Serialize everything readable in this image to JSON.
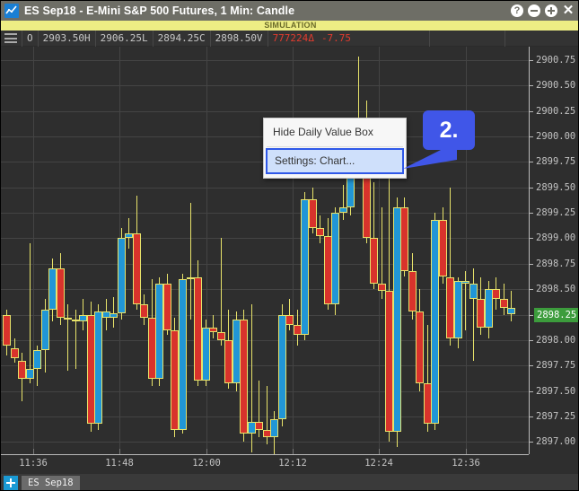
{
  "window": {
    "title": "ES Sep18 - E-Mini S&P 500 Futures, 1 Min: Candle",
    "app_icon": "line-chart-icon",
    "buttons": {
      "help": "?",
      "minimize": "−",
      "maximize": "+",
      "close": "✕"
    }
  },
  "banner": {
    "text": "SIMULATION",
    "background": "#eded84",
    "color": "#6b6b2a"
  },
  "data_bar": {
    "menu_icon": "hamburger-icon",
    "cells": [
      {
        "label": "O",
        "value": ""
      },
      {
        "label": "2903.50H",
        "value": ""
      },
      {
        "label": "2906.25L",
        "value": ""
      },
      {
        "label": "2894.25C",
        "value": ""
      },
      {
        "label": "2898.50V",
        "value": ""
      },
      {
        "label": "777224",
        "value": ""
      }
    ],
    "open": "O",
    "high": "2903.50H",
    "low": "2906.25L",
    "close": "2894.25C",
    "volume_price": "2898.50V",
    "volume": "777224",
    "delta_symbol": "Δ",
    "delta_value": "-7.75",
    "delta_color": "#e23b2e"
  },
  "context_menu": {
    "items": [
      {
        "label": "Hide Daily Value Box",
        "selected": false
      },
      {
        "label": "Settings: Chart...",
        "selected": true
      }
    ],
    "highlight_color": "#2f58e8"
  },
  "callout": {
    "number": "2.",
    "color": "#4056e8"
  },
  "tabbar": {
    "add_label": "+",
    "tabs": [
      {
        "label": "ES Sep18",
        "active": true
      }
    ]
  },
  "chart_data": {
    "type": "candlestick",
    "title": "ES Sep18 - E-Mini S&P 500 Futures, 1 Min: Candle",
    "xlabel": "",
    "ylabel": "",
    "grid": true,
    "legend": "none",
    "up_color": "#2196d6",
    "down_color": "#d8332c",
    "wick_color": "#e8e36a",
    "background": "#2e2e2e",
    "ylim": [
      2896.88,
      2900.88
    ],
    "price_ticks": [
      "2900.75",
      "2900.50",
      "2900.25",
      "2900.00",
      "2899.75",
      "2899.50",
      "2899.25",
      "2899.00",
      "2898.75",
      "2898.50",
      "2898.25",
      "2898.00",
      "2897.75",
      "2897.50",
      "2897.25",
      "2897.00"
    ],
    "current_price": "2898.25",
    "current_price_color": "#3c9c3c",
    "time_ticks": [
      "11:36",
      "11:48",
      "12:00",
      "12:12",
      "12:24",
      "12:36"
    ],
    "tick_interval_minutes": 12,
    "bar_interval": "1 Min",
    "candles": [
      {
        "o": 2898.25,
        "h": 2898.3,
        "l": 2897.85,
        "c": 2897.95,
        "dir": "down"
      },
      {
        "o": 2897.92,
        "h": 2898.02,
        "l": 2897.78,
        "c": 2897.82,
        "dir": "down"
      },
      {
        "o": 2897.8,
        "h": 2897.88,
        "l": 2897.4,
        "c": 2897.62,
        "dir": "down"
      },
      {
        "o": 2897.62,
        "h": 2898.95,
        "l": 2897.58,
        "c": 2897.72,
        "dir": "up"
      },
      {
        "o": 2897.72,
        "h": 2897.95,
        "l": 2897.55,
        "c": 2897.9,
        "dir": "up"
      },
      {
        "o": 2897.9,
        "h": 2898.4,
        "l": 2897.68,
        "c": 2898.3,
        "dir": "up"
      },
      {
        "o": 2898.3,
        "h": 2898.8,
        "l": 2898.18,
        "c": 2898.7,
        "dir": "up"
      },
      {
        "o": 2898.7,
        "h": 2898.85,
        "l": 2898.15,
        "c": 2898.22,
        "dir": "down"
      },
      {
        "o": 2898.22,
        "h": 2898.35,
        "l": 2897.7,
        "c": 2898.2,
        "dir": "up"
      },
      {
        "o": 2898.2,
        "h": 2898.3,
        "l": 2897.72,
        "c": 2898.18,
        "dir": "up"
      },
      {
        "o": 2898.18,
        "h": 2898.4,
        "l": 2898.1,
        "c": 2898.25,
        "dir": "up"
      },
      {
        "o": 2898.25,
        "h": 2898.38,
        "l": 2897.1,
        "c": 2897.18,
        "dir": "down"
      },
      {
        "o": 2897.18,
        "h": 2898.35,
        "l": 2897.12,
        "c": 2898.28,
        "dir": "up"
      },
      {
        "o": 2898.28,
        "h": 2898.4,
        "l": 2898.1,
        "c": 2898.22,
        "dir": "up"
      },
      {
        "o": 2898.22,
        "h": 2898.42,
        "l": 2898.12,
        "c": 2898.26,
        "dir": "up"
      },
      {
        "o": 2898.26,
        "h": 2899.1,
        "l": 2898.2,
        "c": 2899.0,
        "dir": "up"
      },
      {
        "o": 2899.0,
        "h": 2899.2,
        "l": 2898.9,
        "c": 2899.05,
        "dir": "up"
      },
      {
        "o": 2899.05,
        "h": 2899.42,
        "l": 2898.3,
        "c": 2898.35,
        "dir": "down"
      },
      {
        "o": 2898.35,
        "h": 2898.45,
        "l": 2898.15,
        "c": 2898.22,
        "dir": "down"
      },
      {
        "o": 2898.22,
        "h": 2898.6,
        "l": 2897.55,
        "c": 2897.62,
        "dir": "down"
      },
      {
        "o": 2897.62,
        "h": 2898.62,
        "l": 2897.55,
        "c": 2898.55,
        "dir": "up"
      },
      {
        "o": 2898.55,
        "h": 2898.65,
        "l": 2898.05,
        "c": 2898.1,
        "dir": "down"
      },
      {
        "o": 2898.1,
        "h": 2898.22,
        "l": 2897.05,
        "c": 2897.12,
        "dir": "down"
      },
      {
        "o": 2897.12,
        "h": 2898.65,
        "l": 2897.08,
        "c": 2898.6,
        "dir": "up"
      },
      {
        "o": 2898.6,
        "h": 2899.35,
        "l": 2898.2,
        "c": 2898.62,
        "dir": "up"
      },
      {
        "o": 2898.62,
        "h": 2898.78,
        "l": 2897.55,
        "c": 2897.6,
        "dir": "down"
      },
      {
        "o": 2897.6,
        "h": 2898.2,
        "l": 2897.55,
        "c": 2898.12,
        "dir": "up"
      },
      {
        "o": 2898.12,
        "h": 2898.25,
        "l": 2898.02,
        "c": 2898.08,
        "dir": "down"
      },
      {
        "o": 2898.08,
        "h": 2899.0,
        "l": 2897.95,
        "c": 2898.0,
        "dir": "down"
      },
      {
        "o": 2898.0,
        "h": 2898.3,
        "l": 2897.52,
        "c": 2897.58,
        "dir": "down"
      },
      {
        "o": 2897.58,
        "h": 2898.28,
        "l": 2897.5,
        "c": 2898.2,
        "dir": "up"
      },
      {
        "o": 2898.2,
        "h": 2898.3,
        "l": 2897.0,
        "c": 2897.08,
        "dir": "down"
      },
      {
        "o": 2897.08,
        "h": 2898.35,
        "l": 2896.9,
        "c": 2897.2,
        "dir": "up"
      },
      {
        "o": 2897.2,
        "h": 2897.6,
        "l": 2897.05,
        "c": 2897.12,
        "dir": "down"
      },
      {
        "o": 2897.12,
        "h": 2897.55,
        "l": 2896.98,
        "c": 2897.05,
        "dir": "down"
      },
      {
        "o": 2897.05,
        "h": 2897.3,
        "l": 2896.8,
        "c": 2897.22,
        "dir": "up"
      },
      {
        "o": 2897.22,
        "h": 2898.35,
        "l": 2897.15,
        "c": 2898.25,
        "dir": "up"
      },
      {
        "o": 2898.25,
        "h": 2898.4,
        "l": 2898.1,
        "c": 2898.15,
        "dir": "down"
      },
      {
        "o": 2898.15,
        "h": 2898.3,
        "l": 2897.95,
        "c": 2898.05,
        "dir": "down"
      },
      {
        "o": 2898.05,
        "h": 2899.45,
        "l": 2898.0,
        "c": 2899.38,
        "dir": "up"
      },
      {
        "o": 2899.38,
        "h": 2899.5,
        "l": 2899.05,
        "c": 2899.1,
        "dir": "down"
      },
      {
        "o": 2899.1,
        "h": 2899.22,
        "l": 2898.95,
        "c": 2899.02,
        "dir": "down"
      },
      {
        "o": 2899.02,
        "h": 2899.2,
        "l": 2898.3,
        "c": 2898.35,
        "dir": "down"
      },
      {
        "o": 2898.35,
        "h": 2899.3,
        "l": 2898.25,
        "c": 2899.25,
        "dir": "up"
      },
      {
        "o": 2899.25,
        "h": 2899.52,
        "l": 2899.18,
        "c": 2899.3,
        "dir": "up"
      },
      {
        "o": 2899.3,
        "h": 2900.18,
        "l": 2899.22,
        "c": 2900.1,
        "dir": "up"
      },
      {
        "o": 2900.1,
        "h": 2900.78,
        "l": 2899.9,
        "c": 2900.05,
        "dir": "down"
      },
      {
        "o": 2900.05,
        "h": 2900.35,
        "l": 2898.95,
        "c": 2899.0,
        "dir": "down"
      },
      {
        "o": 2899.0,
        "h": 2899.55,
        "l": 2898.5,
        "c": 2898.55,
        "dir": "down"
      },
      {
        "o": 2898.55,
        "h": 2899.3,
        "l": 2898.4,
        "c": 2898.48,
        "dir": "down"
      },
      {
        "o": 2898.48,
        "h": 2899.6,
        "l": 2897.0,
        "c": 2897.1,
        "dir": "down"
      },
      {
        "o": 2897.1,
        "h": 2899.4,
        "l": 2896.95,
        "c": 2899.3,
        "dir": "up"
      },
      {
        "o": 2899.3,
        "h": 2899.4,
        "l": 2898.62,
        "c": 2898.68,
        "dir": "down"
      },
      {
        "o": 2898.68,
        "h": 2898.85,
        "l": 2898.2,
        "c": 2898.28,
        "dir": "down"
      },
      {
        "o": 2898.28,
        "h": 2898.5,
        "l": 2897.5,
        "c": 2897.58,
        "dir": "down"
      },
      {
        "o": 2897.58,
        "h": 2898.15,
        "l": 2897.1,
        "c": 2897.18,
        "dir": "down"
      },
      {
        "o": 2897.18,
        "h": 2899.25,
        "l": 2897.12,
        "c": 2899.18,
        "dir": "up"
      },
      {
        "o": 2899.18,
        "h": 2899.3,
        "l": 2898.55,
        "c": 2898.62,
        "dir": "down"
      },
      {
        "o": 2898.62,
        "h": 2899.5,
        "l": 2897.95,
        "c": 2898.02,
        "dir": "down"
      },
      {
        "o": 2898.02,
        "h": 2898.62,
        "l": 2897.92,
        "c": 2898.58,
        "dir": "up"
      },
      {
        "o": 2898.58,
        "h": 2898.68,
        "l": 2898.1,
        "c": 2898.55,
        "dir": "up"
      },
      {
        "o": 2898.55,
        "h": 2898.7,
        "l": 2897.8,
        "c": 2898.4,
        "dir": "up"
      },
      {
        "o": 2898.4,
        "h": 2898.62,
        "l": 2898.05,
        "c": 2898.12,
        "dir": "down"
      },
      {
        "o": 2898.12,
        "h": 2898.58,
        "l": 2898.02,
        "c": 2898.5,
        "dir": "up"
      },
      {
        "o": 2898.5,
        "h": 2898.62,
        "l": 2898.3,
        "c": 2898.4,
        "dir": "down"
      },
      {
        "o": 2898.4,
        "h": 2898.55,
        "l": 2898.25,
        "c": 2898.32,
        "dir": "down"
      },
      {
        "o": 2898.32,
        "h": 2898.48,
        "l": 2898.18,
        "c": 2898.25,
        "dir": "up"
      }
    ]
  }
}
